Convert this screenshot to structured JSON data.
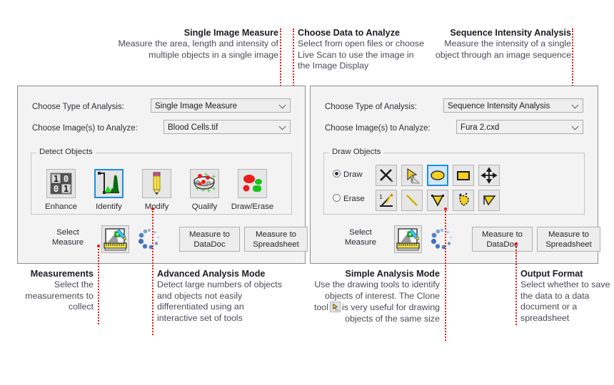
{
  "top_callouts": [
    {
      "id": "single-image-measure",
      "title": "Single Image Measure",
      "body": "Measure the area, length and intensity of multiple objects in a single image"
    },
    {
      "id": "choose-data-to-analyze",
      "title": "Choose Data to Analyze",
      "body": "Select from open files or choose Live Scan to use the image in the Image Display"
    },
    {
      "id": "sequence-intensity-analysis",
      "title": "Sequence Intensity Analysis",
      "body": "Measure the intensity of a single object through an image sequence"
    }
  ],
  "bottom_callouts": [
    {
      "id": "measurements",
      "title": "Measurements",
      "body": "Select the measurements to collect"
    },
    {
      "id": "advanced-analysis-mode",
      "title": "Advanced Analysis Mode",
      "body": "Detect large numbers of objects and objects not easily differentiated using an interactive set of tools"
    },
    {
      "id": "simple-analysis-mode",
      "title": "Simple Analysis Mode",
      "body_1": "Use the drawing tools to identify objects of interest. The Clone tool",
      "body_2": "is very useful for drawing objects of the same size"
    },
    {
      "id": "output-format",
      "title": "Output Format",
      "body": "Select whether to save the data to a data document or a spreadsheet"
    }
  ],
  "left_panel": {
    "type_label": "Choose Type of Analysis:",
    "type_value": "Single Image Measure",
    "image_label": "Choose Image(s) to Analyze:",
    "image_value": "Blood Cells.tif",
    "group_title": "Detect Objects",
    "tools": [
      {
        "name": "enhance-tool",
        "caption": "Enhance",
        "icon": "binary-grid-icon",
        "selected": false
      },
      {
        "name": "identify-tool",
        "caption": "Identify",
        "icon": "histogram-icon",
        "selected": true
      },
      {
        "name": "modify-tool",
        "caption": "Modify",
        "icon": "pencil-icon",
        "selected": false
      },
      {
        "name": "qualify-tool",
        "caption": "Qualify",
        "icon": "sieve-icon",
        "selected": false
      },
      {
        "name": "draw-erase-tool",
        "caption": "Draw/Erase",
        "icon": "blobs-icon",
        "selected": false
      }
    ],
    "select_measure_label": "Select\nMeasure",
    "select_measure_line1": "Select",
    "select_measure_line2": "Measure",
    "datadoc_button": "Measure to\nDataDoc",
    "datadoc_line1": "Measure to",
    "datadoc_line2": "DataDoc",
    "spreadsheet_line1": "Measure to",
    "spreadsheet_line2": "Spreadsheet"
  },
  "right_panel": {
    "type_label": "Choose Type of Analysis:",
    "type_value": "Sequence Intensity Analysis",
    "image_label": "Choose Image(s) to Analyze:",
    "image_value": "Fura 2.cxd",
    "group_title": "Draw Objects",
    "draw_radio": "Draw",
    "erase_radio": "Erase",
    "draw_tools": [
      {
        "name": "point-cross-tool",
        "icon": "cross-icon",
        "selected": false
      },
      {
        "name": "clone-tool",
        "icon": "clone-arrow-icon",
        "selected": false
      },
      {
        "name": "ellipse-tool",
        "icon": "ellipse-icon",
        "selected": true
      },
      {
        "name": "rectangle-tool",
        "icon": "rectangle-icon",
        "selected": false
      },
      {
        "name": "move-tool",
        "icon": "move-arrows-icon",
        "selected": false
      }
    ],
    "erase_tools": [
      {
        "name": "angle-tool",
        "icon": "angle-icon",
        "selected": false
      },
      {
        "name": "line-tool",
        "icon": "line-icon",
        "selected": false
      },
      {
        "name": "polygon-tool",
        "icon": "polygon-icon",
        "selected": false
      },
      {
        "name": "freehand-tool",
        "icon": "freehand-polygon-icon",
        "selected": false
      },
      {
        "name": "traced-polygon-tool",
        "icon": "traced-polygon-icon",
        "selected": false
      }
    ],
    "select_measure_line1": "Select",
    "select_measure_line2": "Measure",
    "datadoc_line1": "Measure to",
    "datadoc_line2": "DataDoc",
    "spreadsheet_line1": "Measure to",
    "spreadsheet_line2": "Spreadsheet"
  },
  "colors": {
    "leader": "#e8180c",
    "selection": "#1d8fe0",
    "panel_bg": "#f3f3f3",
    "panel_border": "#8c8c8c"
  }
}
